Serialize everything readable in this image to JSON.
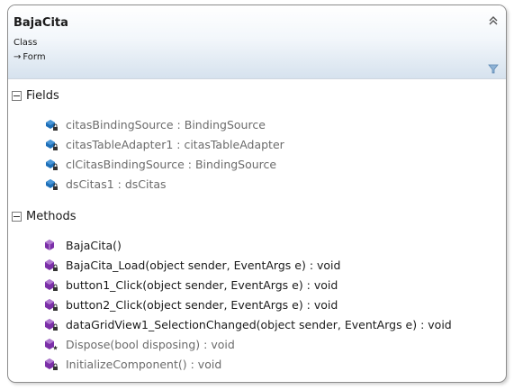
{
  "class": {
    "name": "BajaCita",
    "stereotype": "Class",
    "base_arrow": "→",
    "base": "Form"
  },
  "icons": {
    "collapse": "double-chevron-up-icon",
    "filter": "filter-funnel-icon",
    "field": "field-private-icon",
    "method": "method-icon",
    "method_private": "method-private-icon",
    "method_protected": "method-protected-icon"
  },
  "colors": {
    "field_icon": "#1e6fb8",
    "method_icon": "#7b2fa8",
    "header_bottom": "#d6e2ee"
  },
  "fields": {
    "title": "Fields",
    "items": [
      {
        "label": "citasBindingSource : BindingSource"
      },
      {
        "label": "citasTableAdapter1 : citasTableAdapter"
      },
      {
        "label": "clCitasBindingSource : BindingSource"
      },
      {
        "label": "dsCitas1 : dsCitas"
      }
    ]
  },
  "methods": {
    "title": "Methods",
    "items": [
      {
        "label": "BajaCita()"
      },
      {
        "label": "BajaCita_Load(object sender, EventArgs e) : void"
      },
      {
        "label": "button1_Click(object sender, EventArgs e) : void"
      },
      {
        "label": "button2_Click(object sender, EventArgs e) : void"
      },
      {
        "label": "dataGridView1_SelectionChanged(object sender, EventArgs e) : void"
      },
      {
        "label": "Dispose(bool disposing) : void"
      },
      {
        "label": "InitializeComponent() : void"
      }
    ]
  }
}
